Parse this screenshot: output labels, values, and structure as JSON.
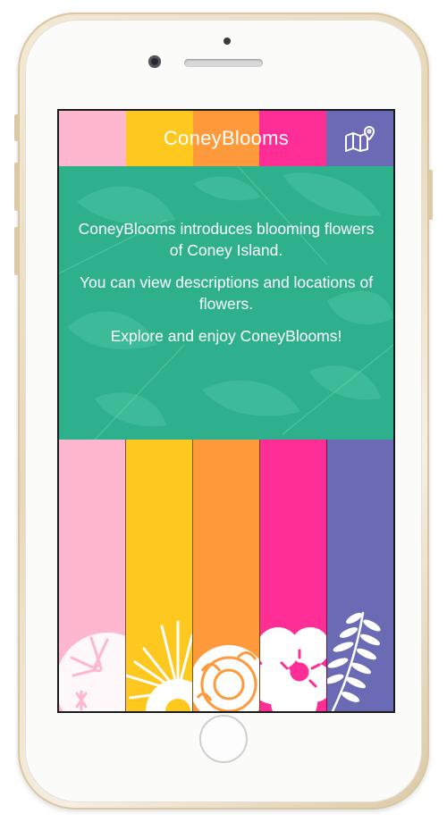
{
  "app": {
    "title": "ConeyBlooms"
  },
  "header": {
    "stripe_colors": [
      "#ffb7d0",
      "#ffc81e",
      "#ff9a3c",
      "#ff2d96",
      "#6b6bb5"
    ],
    "map_icon": "map-pin-icon"
  },
  "intro": {
    "background": "#2fb08d",
    "line1": "ConeyBlooms introduces blooming flowers of Coney Island.",
    "line2": "You can view descriptions and locations of flowers.",
    "line3": "Explore and enjoy ConeyBlooms!"
  },
  "categories": [
    {
      "color": "#ffb7d0",
      "icon": "sand-dollar-icon"
    },
    {
      "color": "#ffc81e",
      "icon": "daisy-flower-icon"
    },
    {
      "color": "#ff9a3c",
      "icon": "marigold-flower-icon"
    },
    {
      "color": "#ff2d96",
      "icon": "rose-flower-icon"
    },
    {
      "color": "#6b6bb5",
      "icon": "fern-leaf-icon"
    }
  ]
}
